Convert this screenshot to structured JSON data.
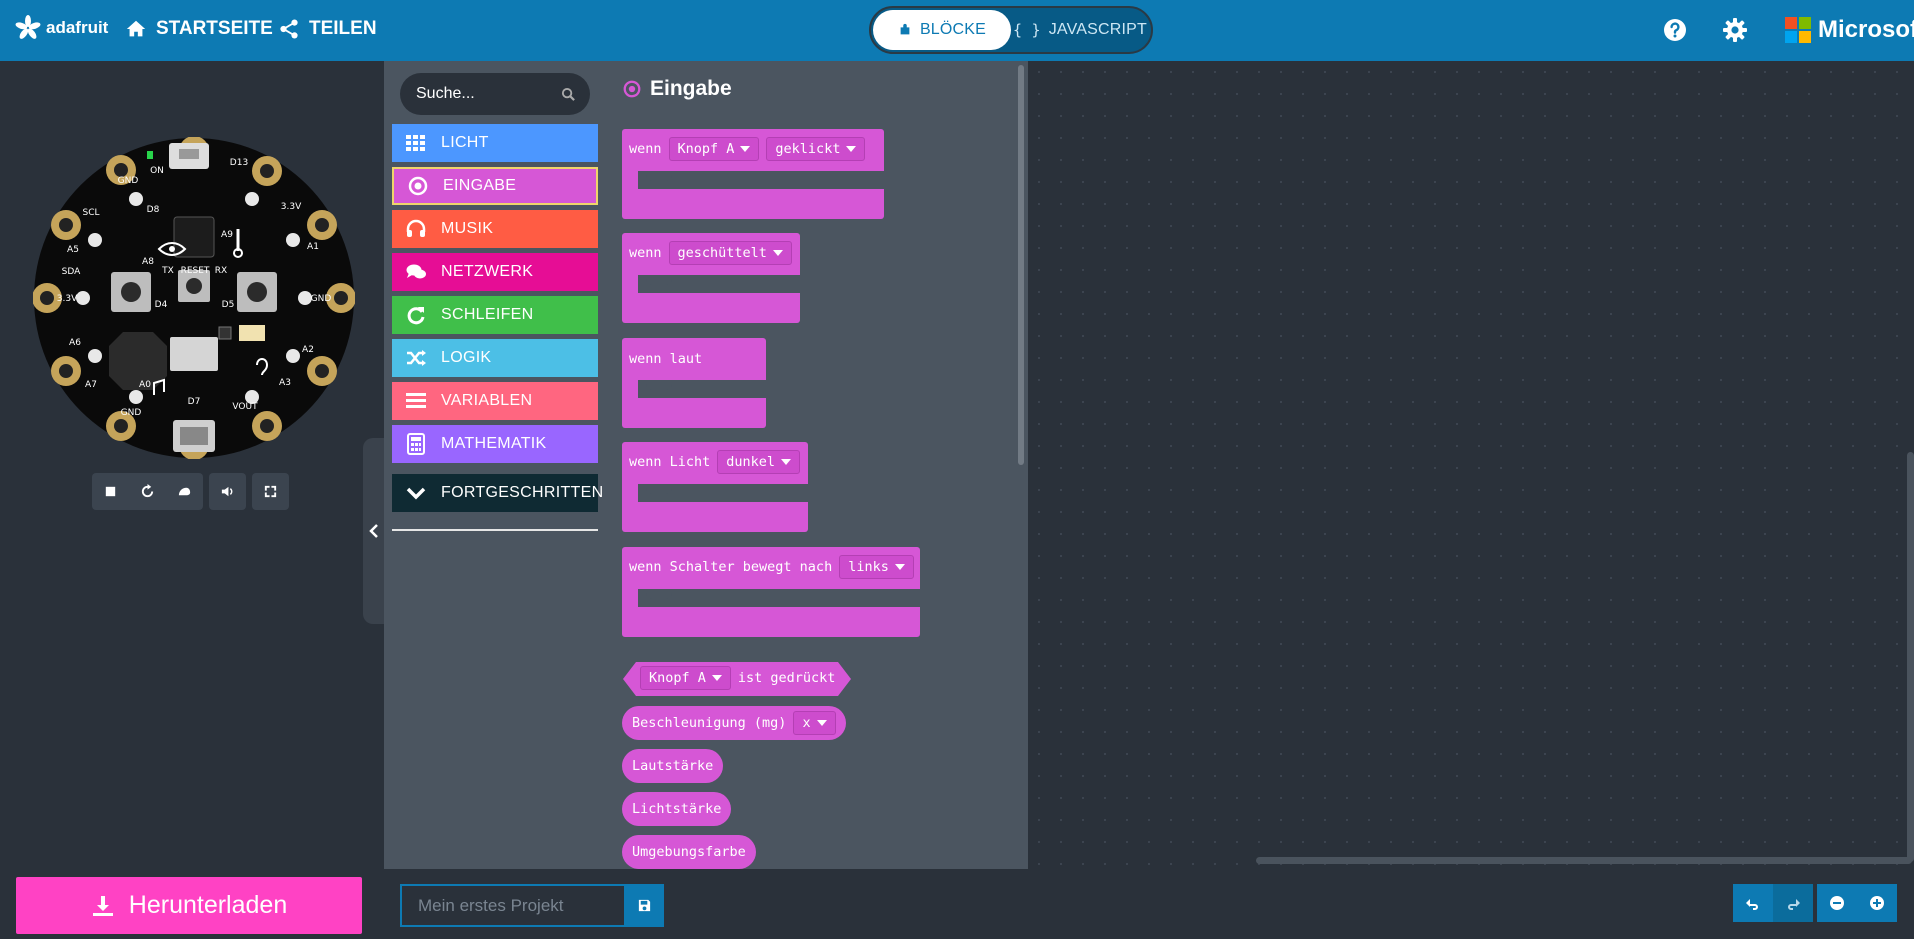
{
  "topbar": {
    "brand": "adafruit",
    "nav": [
      {
        "label": "STARTSEITE",
        "icon": "home-icon"
      },
      {
        "label": "TEILEN",
        "icon": "share-icon"
      }
    ],
    "editor_toggle": {
      "blocks_label": "BLÖCKE",
      "js_label": "JAVASCRIPT",
      "active": "blocks"
    },
    "vendor": "Microsoft",
    "colors": {
      "bar": "#0d7ab3",
      "active_tab_bg": "#ffffff"
    }
  },
  "simulator": {
    "pin_labels": [
      "D13",
      "3.3V",
      "A1",
      "A2",
      "GND",
      "A3",
      "A4",
      "A5",
      "A6",
      "A7",
      "GND",
      "VOUT",
      "SCL",
      "SDA",
      "RX",
      "TX",
      "A0",
      "D4",
      "D5",
      "D7",
      "D8",
      "A8",
      "A9",
      "RESET",
      "ON"
    ],
    "controls": [
      "stop-icon",
      "restart-icon",
      "slow-mode-icon",
      "sound-icon",
      "fullscreen-icon"
    ]
  },
  "toolbox": {
    "search_placeholder": "Suche...",
    "categories": [
      {
        "label": "LICHT",
        "color": "#4c97ff",
        "icon": "grid-icon"
      },
      {
        "label": "EINGABE",
        "color": "#d657d6",
        "icon": "radio-target-icon",
        "selected": true
      },
      {
        "label": "MUSIK",
        "color": "#ff5c44",
        "icon": "headphones-icon"
      },
      {
        "label": "NETZWERK",
        "color": "#e60d95",
        "icon": "chat-icon"
      },
      {
        "label": "SCHLEIFEN",
        "color": "#40bf4a",
        "icon": "loop-icon"
      },
      {
        "label": "LOGIK",
        "color": "#4cbfe6",
        "icon": "shuffle-icon"
      },
      {
        "label": "VARIABLEN",
        "color": "#ff6680",
        "icon": "list-icon"
      },
      {
        "label": "MATHEMATIK",
        "color": "#9966ff",
        "icon": "calculator-icon"
      },
      {
        "label": "FORTGESCHRITTEN",
        "color": "#0f2a33",
        "icon": "chevron-down-icon"
      }
    ]
  },
  "flyout": {
    "title": "Eingabe",
    "color": "#d657d6",
    "event_blocks": [
      {
        "keyword": "wenn",
        "parts": [
          {
            "dropdown": "Knopf A"
          },
          {
            "dropdown": "geklickt"
          }
        ]
      },
      {
        "keyword": "wenn",
        "parts": [
          {
            "dropdown": "geschüttelt"
          }
        ]
      },
      {
        "keyword": "wenn laut",
        "parts": []
      },
      {
        "keyword": "wenn Licht",
        "parts": [
          {
            "dropdown": "dunkel"
          }
        ]
      },
      {
        "keyword": "wenn Schalter bewegt nach",
        "parts": [
          {
            "dropdown": "links"
          }
        ]
      }
    ],
    "reporter_blocks": {
      "pressed": {
        "dropdown": "Knopf A",
        "text": "ist gedrückt"
      },
      "accel": {
        "text": "Beschleunigung (mg)",
        "dropdown": "x"
      },
      "loudness": "Lautstärke",
      "light": "Lichtstärke",
      "ambient": "Umgebungsfarbe"
    }
  },
  "bottombar": {
    "download_label": "Herunterladen",
    "download_color": "#ff42c4",
    "project_name_placeholder": "Mein erstes Projekt",
    "icons": [
      "undo-icon",
      "redo-icon",
      "zoom-out-icon",
      "zoom-in-icon"
    ]
  }
}
